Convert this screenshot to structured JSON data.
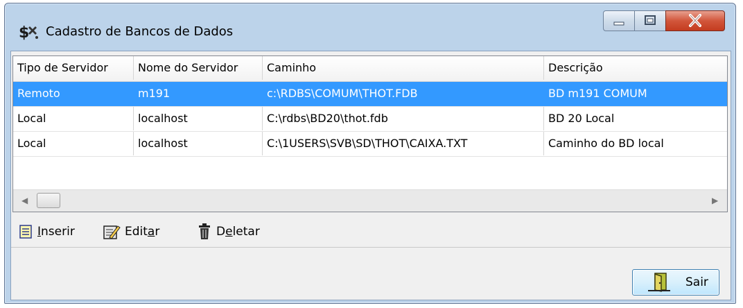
{
  "window": {
    "title": "Cadastro de Bancos de Dados",
    "icon": "dollar-app-icon"
  },
  "grid": {
    "columns": [
      "Tipo de Servidor",
      "Nome do Servidor",
      "Caminho",
      "Descrição"
    ],
    "rows": [
      [
        "Remoto",
        "m191",
        "c:\\RDBS\\COMUM\\THOT.FDB",
        "BD m191 COMUM"
      ],
      [
        "Local",
        "localhost",
        "C:\\rdbs\\BD20\\thot.fdb",
        "BD 20 Local"
      ],
      [
        "Local",
        "localhost",
        "C:\\1USERS\\SVB\\SD\\THOT\\CAIXA.TXT",
        "Caminho do BD local"
      ]
    ],
    "selected_row": 0
  },
  "toolbar": {
    "insert": {
      "prefix": "",
      "key": "I",
      "suffix": "nserir",
      "icon": "insert-icon"
    },
    "edit": {
      "prefix": "Edit",
      "key": "a",
      "suffix": "r",
      "icon": "edit-icon"
    },
    "delete": {
      "prefix": "D",
      "key": "e",
      "suffix": "letar",
      "icon": "trash-icon"
    }
  },
  "footer": {
    "exit_label": "Sair",
    "exit_icon": "door-exit-icon"
  },
  "colors": {
    "selection": "#3399ff",
    "close_button": "#c43b1f"
  }
}
